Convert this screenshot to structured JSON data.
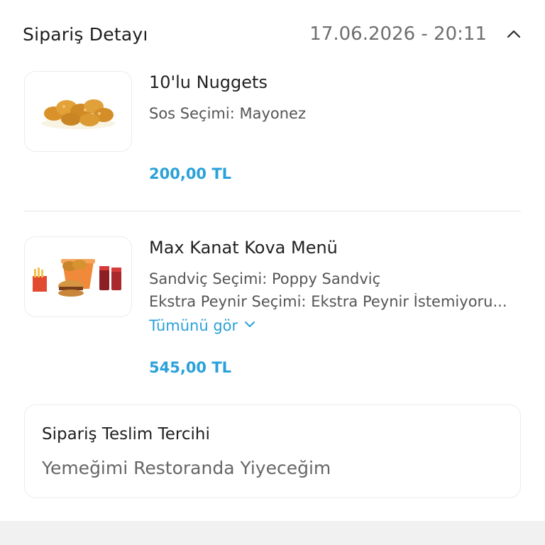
{
  "header": {
    "title": "Sipariş Detayı",
    "datetime": "17.06.2026 - 20:11",
    "collapse_icon": "chevron-up-icon"
  },
  "items": [
    {
      "name": "10'lu Nuggets",
      "options": [
        {
          "key": "Sos Seçimi:",
          "value": "Mayonez"
        }
      ],
      "price": "200,00 TL",
      "image_icon": "nuggets-image"
    },
    {
      "name": "Max Kanat Kova Menü",
      "options": [
        {
          "key": "Sandviç Seçimi:",
          "value": "Poppy Sandviç"
        },
        {
          "key": "Ekstra Peynir Seçimi:",
          "value": "Ekstra Peynir İstemiyoru..."
        }
      ],
      "see_all": "Tümünü gör",
      "price": "545,00 TL",
      "image_icon": "bucket-menu-image"
    }
  ],
  "delivery_preference": {
    "title": "Sipariş Teslim Tercihi",
    "value": "Yemeğimi Restoranda Yiyeceğim"
  },
  "colors": {
    "accent": "#2aa1d9",
    "text": "#1f1f1f",
    "muted": "#666666"
  }
}
